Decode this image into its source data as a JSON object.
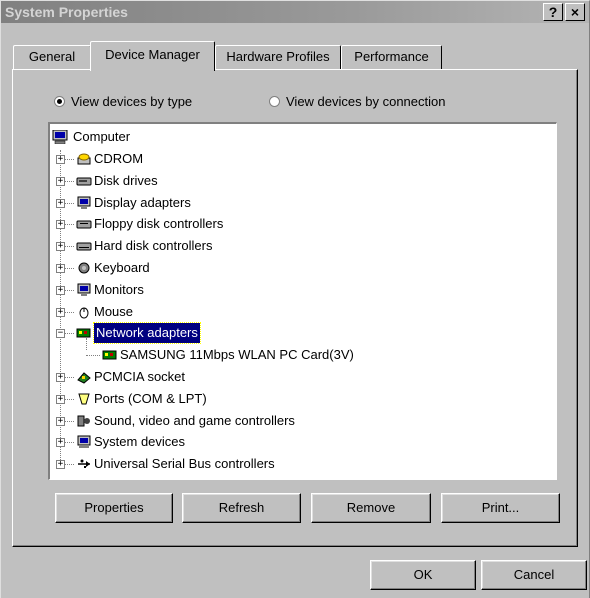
{
  "window": {
    "title": "System Properties",
    "help_label": "?",
    "close_label": "×"
  },
  "tabs": [
    {
      "label": "General",
      "active": false
    },
    {
      "label": "Device Manager",
      "active": true
    },
    {
      "label": "Hardware Profiles",
      "active": false
    },
    {
      "label": "Performance",
      "active": false
    }
  ],
  "view_options": {
    "by_type": {
      "label": "View devices by type",
      "selected": true
    },
    "by_connection": {
      "label": "View devices by connection",
      "selected": false
    }
  },
  "device_tree": {
    "root": {
      "label": "Computer",
      "icon": "computer-icon"
    },
    "items": [
      {
        "label": "CDROM",
        "icon": "cdrom-icon",
        "expanded": false
      },
      {
        "label": "Disk drives",
        "icon": "disk-drive-icon",
        "expanded": false
      },
      {
        "label": "Display adapters",
        "icon": "display-adapter-icon",
        "expanded": false
      },
      {
        "label": "Floppy disk controllers",
        "icon": "floppy-controller-icon",
        "expanded": false
      },
      {
        "label": "Hard disk controllers",
        "icon": "hard-disk-controller-icon",
        "expanded": false
      },
      {
        "label": "Keyboard",
        "icon": "keyboard-icon",
        "expanded": false
      },
      {
        "label": "Monitors",
        "icon": "monitor-icon",
        "expanded": false
      },
      {
        "label": "Mouse",
        "icon": "mouse-icon",
        "expanded": false
      },
      {
        "label": "Network adapters",
        "icon": "network-adapter-icon",
        "expanded": true,
        "selected": true
      },
      {
        "label": "SAMSUNG 11Mbps WLAN PC Card(3V)",
        "icon": "network-card-icon",
        "child": true
      },
      {
        "label": "PCMCIA socket",
        "icon": "pcmcia-icon",
        "expanded": false
      },
      {
        "label": "Ports (COM & LPT)",
        "icon": "port-icon",
        "expanded": false
      },
      {
        "label": "Sound, video and game controllers",
        "icon": "sound-icon",
        "expanded": false
      },
      {
        "label": "System devices",
        "icon": "system-device-icon",
        "expanded": false
      },
      {
        "label": "Universal Serial Bus controllers",
        "icon": "usb-icon",
        "expanded": false
      }
    ]
  },
  "action_buttons": {
    "properties": "Properties",
    "refresh": "Refresh",
    "remove": "Remove",
    "print": "Print..."
  },
  "dialog_buttons": {
    "ok": "OK",
    "cancel": "Cancel"
  }
}
